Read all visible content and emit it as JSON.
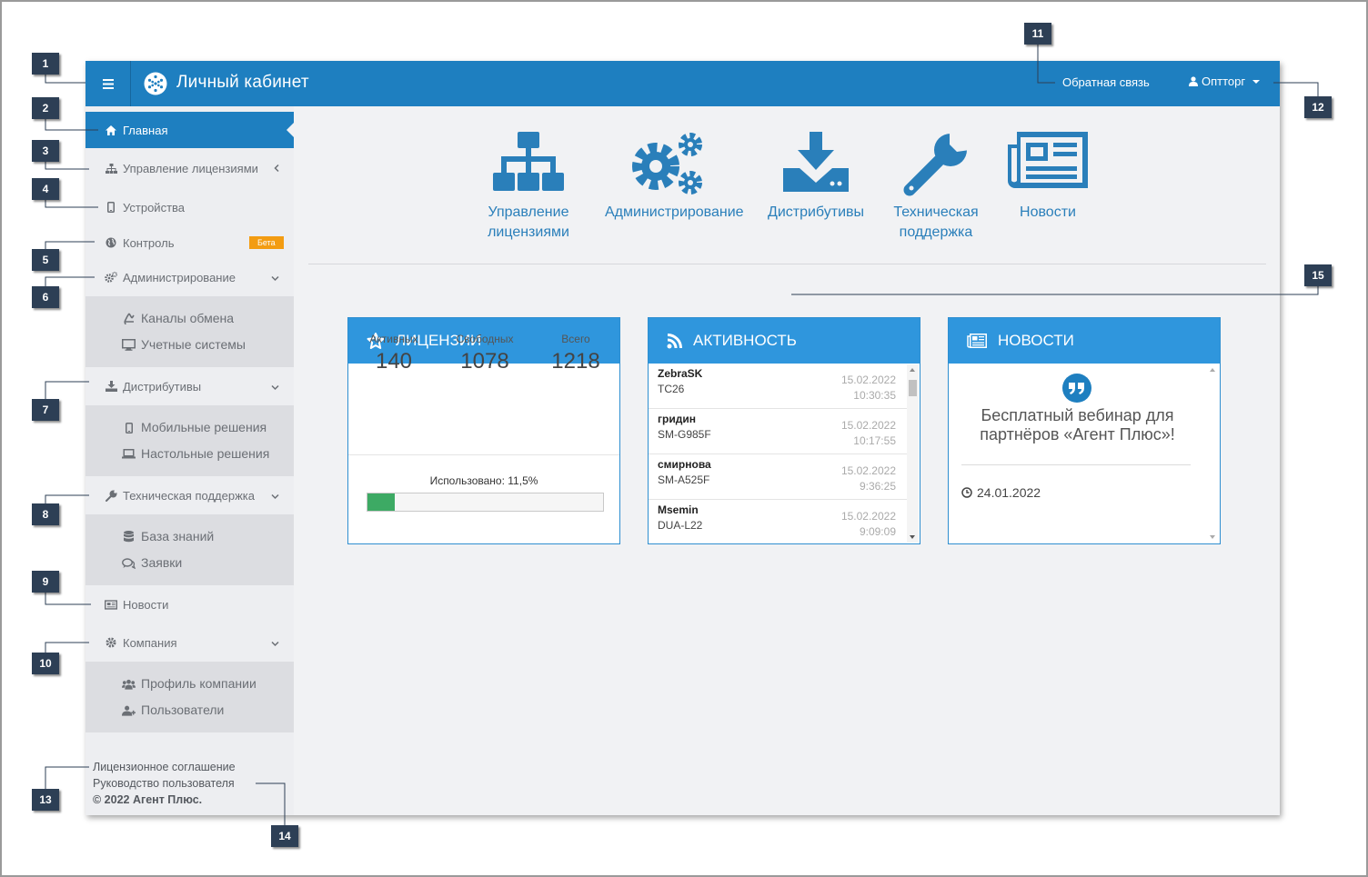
{
  "header": {
    "title": "Личный кабинет",
    "feedback": "Обратная связь",
    "user": "Оптторг"
  },
  "sidebar": {
    "items": [
      {
        "label": "Главная"
      },
      {
        "label": "Управление лицензиями"
      },
      {
        "label": "Устройства"
      },
      {
        "label": "Контроль",
        "badge": "Бета"
      },
      {
        "label": "Администрирование"
      },
      {
        "label": "Дистрибутивы"
      },
      {
        "label": "Техническая поддержка"
      },
      {
        "label": "Новости"
      },
      {
        "label": "Компания"
      }
    ],
    "admin_sub": [
      {
        "label": "Каналы обмена"
      },
      {
        "label": "Учетные системы"
      }
    ],
    "distr_sub": [
      {
        "label": "Мобильные решения"
      },
      {
        "label": "Настольные решения"
      }
    ],
    "support_sub": [
      {
        "label": "База знаний"
      },
      {
        "label": "Заявки"
      }
    ],
    "company_sub": [
      {
        "label": "Профиль компании"
      },
      {
        "label": "Пользователи"
      }
    ],
    "footer": {
      "license": "Лицензионное соглашение",
      "guide": "Руководство пользователя",
      "copyright": "© 2022 Агент Плюс."
    }
  },
  "quick_links": [
    {
      "line1": "Управление",
      "line2": "лицензиями",
      "icon": "sitemap-icon"
    },
    {
      "line1": "Администрирование",
      "line2": "",
      "icon": "gears-icon"
    },
    {
      "line1": "Дистрибутивы",
      "line2": "",
      "icon": "download-icon"
    },
    {
      "line1": "Техническая",
      "line2": "поддержка",
      "icon": "wrench-icon"
    },
    {
      "line1": "Новости",
      "line2": "",
      "icon": "newspaper-icon"
    }
  ],
  "licenses": {
    "title": "Лицензии",
    "active_label": "Активных",
    "active": "140",
    "free_label": "Свободных",
    "free": "1078",
    "total_label": "Всего",
    "total": "1218",
    "used_label": "Использовано: 11,5%",
    "used_fraction": 0.115
  },
  "activity": {
    "title": "Активность",
    "rows": [
      {
        "user": "ZebraSK",
        "device": "TC26",
        "date": "15.02.2022",
        "time": "10:30:35"
      },
      {
        "user": "гридин",
        "device": "SM-G985F",
        "date": "15.02.2022",
        "time": "10:17:55"
      },
      {
        "user": "смирнова",
        "device": "SM-A525F",
        "date": "15.02.2022",
        "time": "9:36:25"
      },
      {
        "user": "Msemin",
        "device": "DUA-L22",
        "date": "15.02.2022",
        "time": "9:09:09"
      }
    ]
  },
  "news": {
    "title": "Новости",
    "headline": "Бесплатный вебинар для партнёров «Агент Плюс»!",
    "date": "24.01.2022"
  },
  "callouts": [
    "1",
    "2",
    "3",
    "4",
    "5",
    "6",
    "7",
    "8",
    "9",
    "10",
    "11",
    "12",
    "13",
    "14",
    "15"
  ],
  "colors": {
    "primary": "#1e7fc0",
    "card_header": "#2f96dd",
    "badge": "#f39c12",
    "progress": "#3daa64",
    "callout": "#2d3f55"
  }
}
